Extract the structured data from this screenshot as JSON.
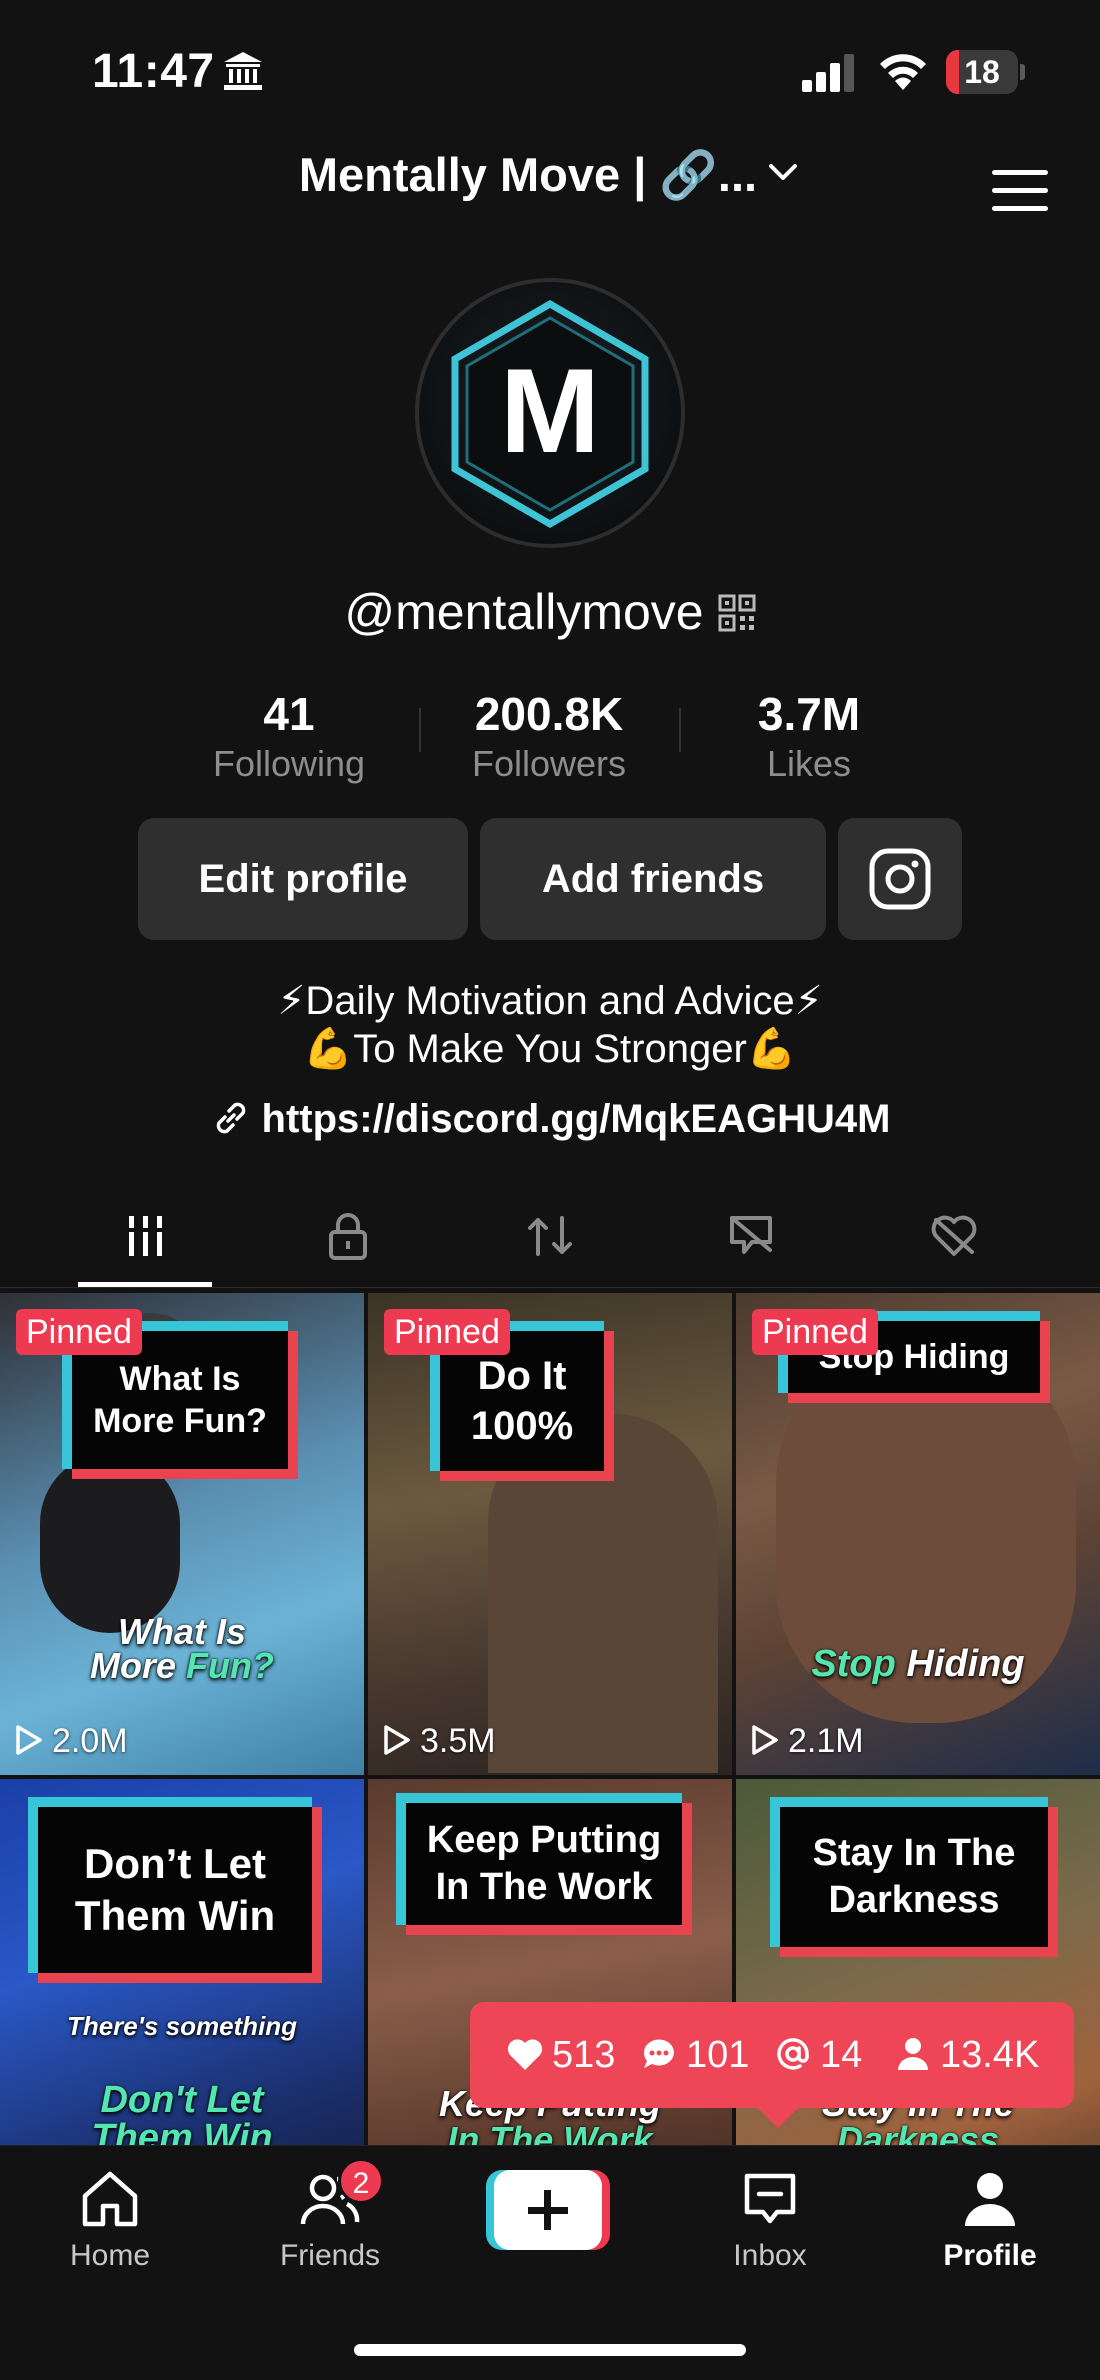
{
  "status_bar": {
    "time": "11:47",
    "battery": "18",
    "battery_level": 0.18
  },
  "header": {
    "title": "Mentally Move | 🔗..."
  },
  "profile": {
    "avatar_letter": "M",
    "username": "@mentallymove",
    "stats": [
      {
        "value": "41",
        "label": "Following"
      },
      {
        "value": "200.8K",
        "label": "Followers"
      },
      {
        "value": "3.7M",
        "label": "Likes"
      }
    ],
    "buttons": {
      "edit": "Edit profile",
      "add_friends": "Add friends"
    },
    "bio": [
      "⚡Daily Motivation and Advice⚡",
      "💪To Make You Stronger💪"
    ],
    "link": "https://discord.gg/MqkEAGHU4M"
  },
  "tabs": [
    {
      "icon": "grid-icon",
      "active": true
    },
    {
      "icon": "lock-icon",
      "active": false
    },
    {
      "icon": "repost-icon",
      "active": false
    },
    {
      "icon": "tagged-icon",
      "active": false
    },
    {
      "icon": "liked-icon",
      "active": false
    }
  ],
  "videos": [
    {
      "pinned": "Pinned",
      "title": "What Is\nMore Fun?",
      "caption_a": "What Is",
      "caption_b": "More ",
      "caption_hl": "Fun?",
      "views": "2.0M"
    },
    {
      "pinned": "Pinned",
      "title": "Do It\n100%",
      "views": "3.5M"
    },
    {
      "pinned": "Pinned",
      "title": "Stop Hiding",
      "caption_a": "",
      "caption_b": "Hiding",
      "caption_hl": "Stop ",
      "views": "2.1M"
    },
    {
      "title": "Don’t Let\nThem Win",
      "caption_sub": "There's something",
      "caption_hl": "Don't Let",
      "caption_b": "Them Win"
    },
    {
      "title": "Keep Putting\nIn The Work",
      "caption_a": "Keep Putting",
      "caption_hl": "In The Work"
    },
    {
      "title": "Stay In The\nDarkness",
      "caption_a": "Stay In The",
      "caption_hl": "Darkness"
    }
  ],
  "activity_bubble": {
    "likes": "513",
    "comments": "101",
    "mentions": "14",
    "followers": "13.4K"
  },
  "bottom_nav": {
    "home": "Home",
    "friends": "Friends",
    "friends_badge": "2",
    "inbox": "Inbox",
    "profile": "Profile"
  },
  "colors": {
    "accent_red": "#ee3a51",
    "accent_cyan": "#37c6d8",
    "background": "#121212"
  }
}
